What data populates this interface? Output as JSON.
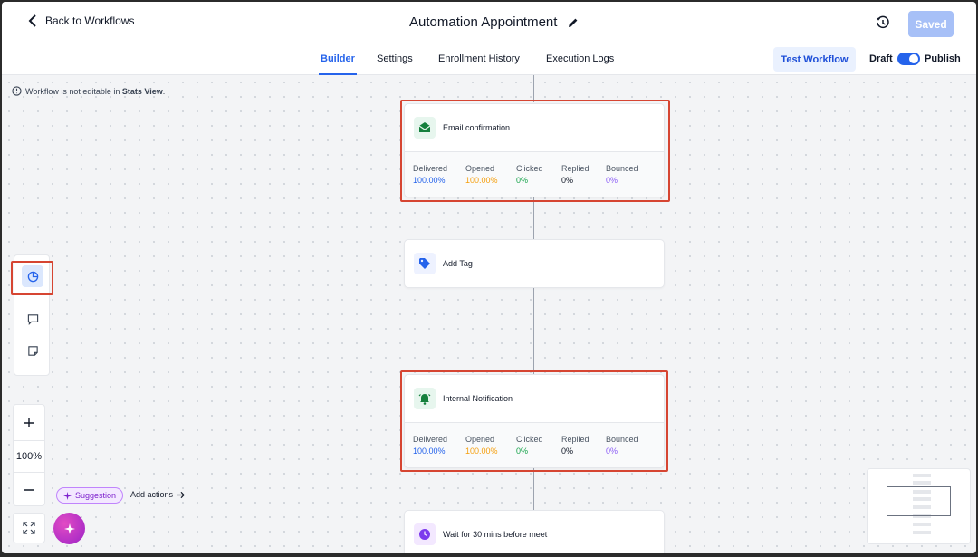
{
  "header": {
    "back_label": "Back to Workflows",
    "title": "Automation Appointment",
    "saved_label": "Saved"
  },
  "tabs": [
    {
      "label": "Builder",
      "active": true
    },
    {
      "label": "Settings",
      "active": false
    },
    {
      "label": "Enrollment History",
      "active": false
    },
    {
      "label": "Execution Logs",
      "active": false
    }
  ],
  "toolbar": {
    "test_workflow_label": "Test Workflow",
    "draft_label": "Draft",
    "publish_label": "Publish",
    "publish_on": true
  },
  "canvas": {
    "notice_prefix": "Workflow is not editable in ",
    "notice_strong": "Stats View",
    "notice_suffix": "."
  },
  "nodes": [
    {
      "title": "Email confirmation",
      "icon": "envelope-open-icon",
      "stats": [
        {
          "label": "Delivered",
          "value": "100.00%",
          "color": "#2563eb"
        },
        {
          "label": "Opened",
          "value": "100.00%",
          "color": "#f59e0b"
        },
        {
          "label": "Clicked",
          "value": "0%",
          "color": "#16a34a"
        },
        {
          "label": "Replied",
          "value": "0%",
          "color": "#111827"
        },
        {
          "label": "Bounced",
          "value": "0%",
          "color": "#8b5cf6"
        }
      ]
    },
    {
      "title": "Add Tag",
      "icon": "tag-icon"
    },
    {
      "title": "Internal Notification",
      "icon": "bell-icon",
      "stats": [
        {
          "label": "Delivered",
          "value": "100.00%",
          "color": "#2563eb"
        },
        {
          "label": "Opened",
          "value": "100.00%",
          "color": "#f59e0b"
        },
        {
          "label": "Clicked",
          "value": "0%",
          "color": "#16a34a"
        },
        {
          "label": "Replied",
          "value": "0%",
          "color": "#111827"
        },
        {
          "label": "Bounced",
          "value": "0%",
          "color": "#8b5cf6"
        }
      ]
    },
    {
      "title": "Wait for 30 mins before meet",
      "icon": "clock-icon"
    }
  ],
  "zoom": {
    "level": "100%"
  },
  "suggestion": {
    "label": "Suggestion",
    "add_actions_label": "Add actions"
  },
  "colors": {
    "accent": "#2563eb",
    "highlight": "#d64532",
    "email_icon_bg": "#e7f6ee",
    "tag_icon": "#2563eb",
    "bell_icon": "#15803d",
    "clock_icon": "#7c3aed"
  }
}
